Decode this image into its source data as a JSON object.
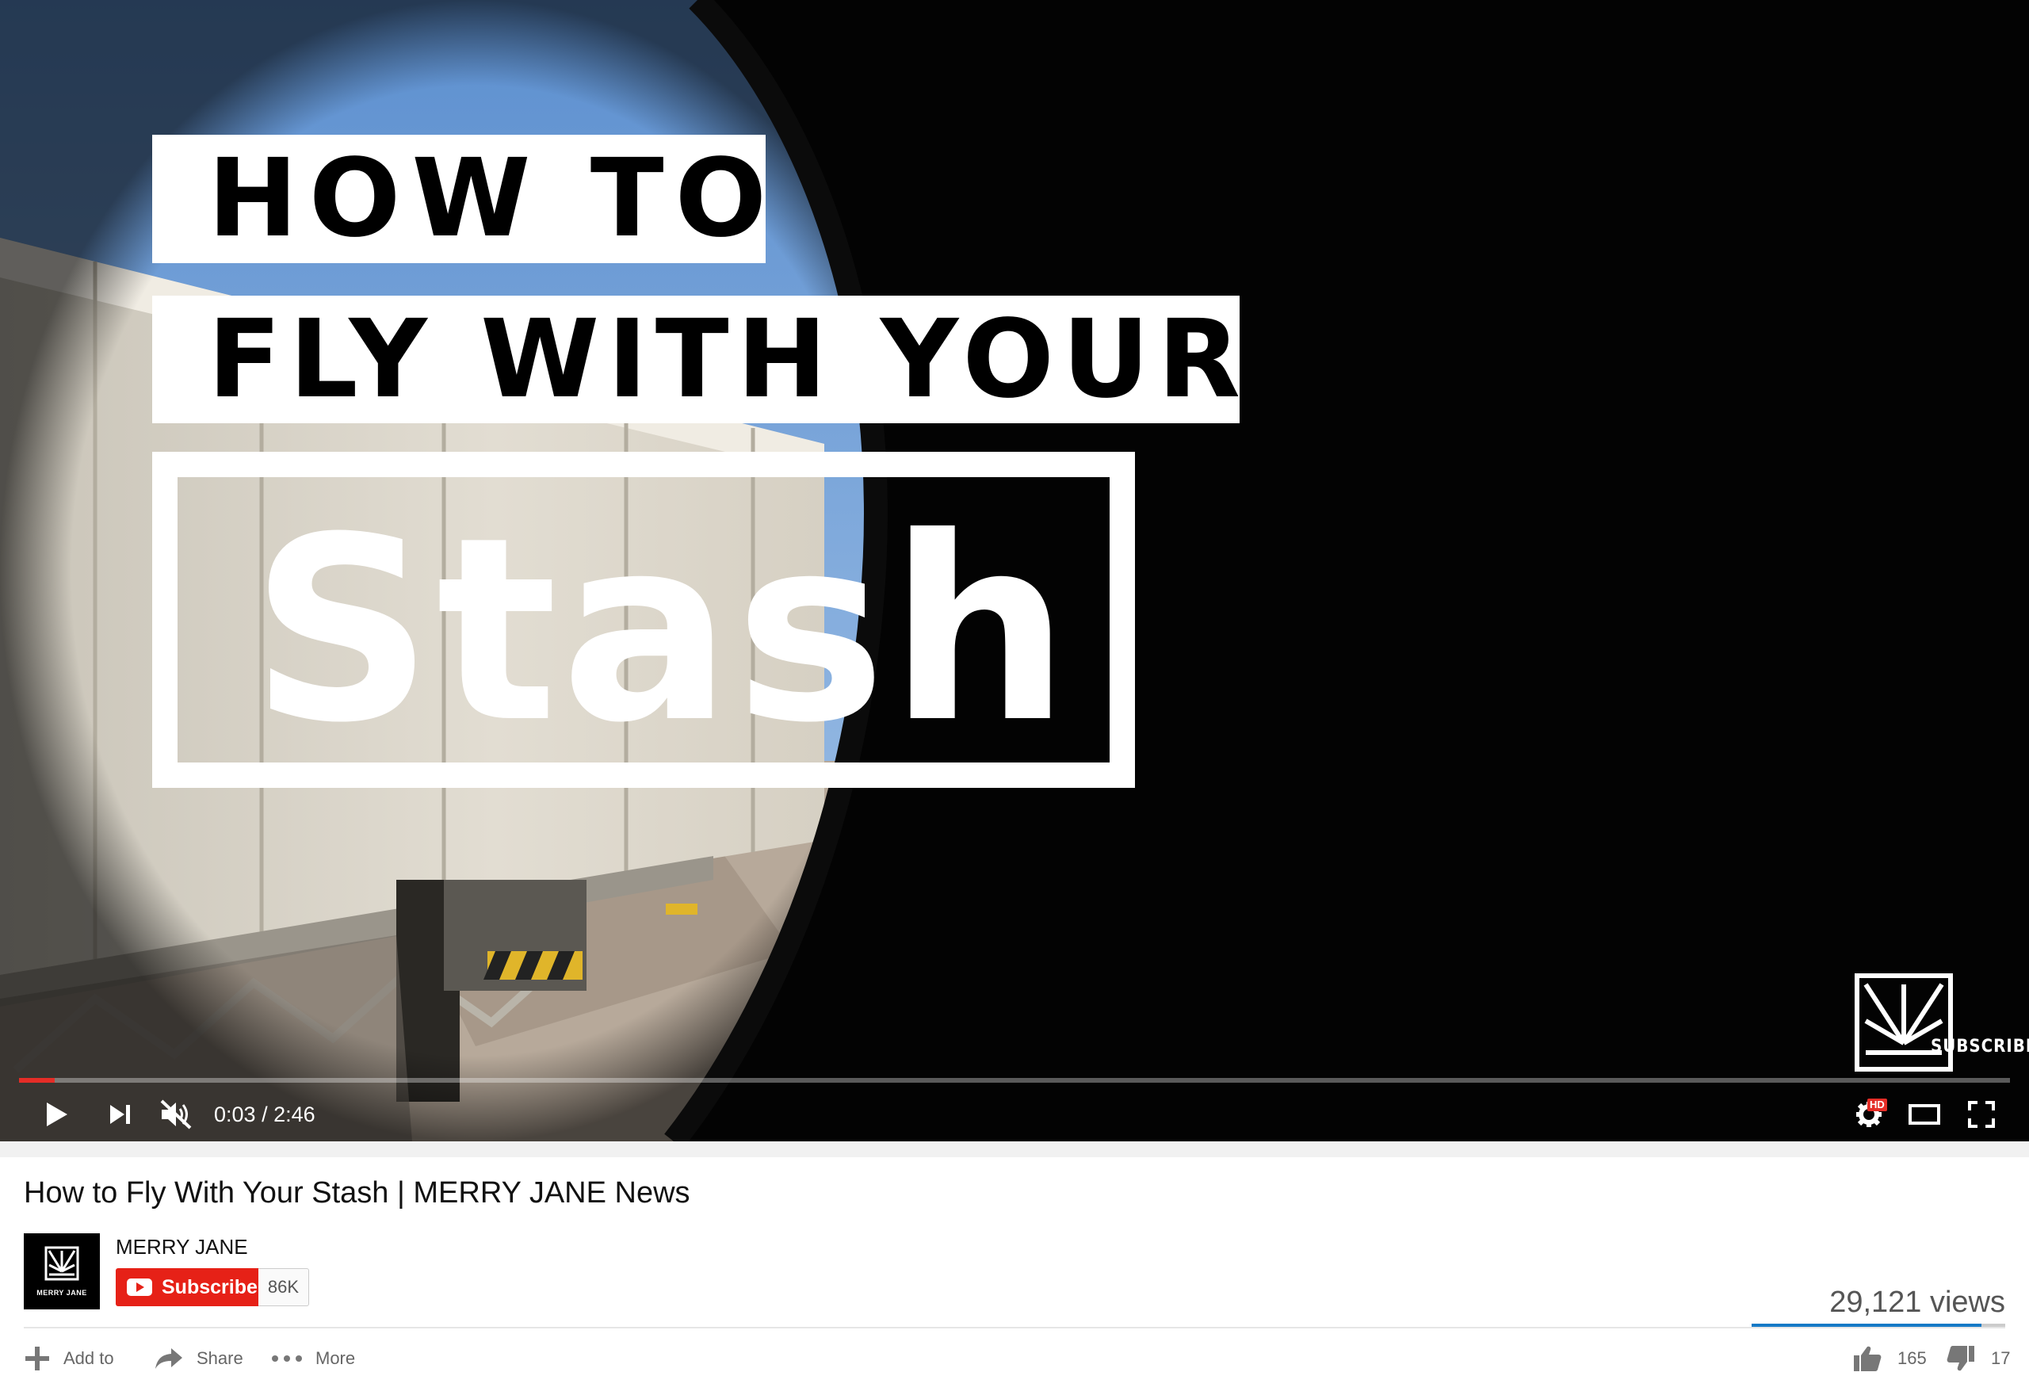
{
  "video": {
    "overlay_line1": "HOW TO",
    "overlay_line2": "FLY WITH YOUR",
    "overlay_line3": "Stash",
    "watermark_label": "SUBSCRIBE",
    "progress_fraction": 0.018,
    "current_time": "0:03",
    "duration": "2:46",
    "time_separator": " / ",
    "hd_badge": "HD",
    "controls": {
      "play": "play-icon",
      "next": "next-icon",
      "mute": "muted-speaker-icon",
      "settings": "gear-icon",
      "theater": "theater-mode-icon",
      "fullscreen": "fullscreen-icon"
    },
    "accent_color": "#e52d27"
  },
  "info": {
    "title": "How to Fly With Your Stash | MERRY JANE News",
    "channel_name": "MERRY JANE",
    "avatar_label": "MERRY JANE",
    "subscribe_label": "Subscribe",
    "subscriber_count": "86K",
    "views": "29,121 views",
    "actions": {
      "add_to": "Add to",
      "share": "Share",
      "more": "More"
    },
    "likes": "165",
    "dislikes": "17",
    "like_fraction": 0.907,
    "subscribe_color": "#e62117",
    "sentiment_color": "#167ac6"
  }
}
